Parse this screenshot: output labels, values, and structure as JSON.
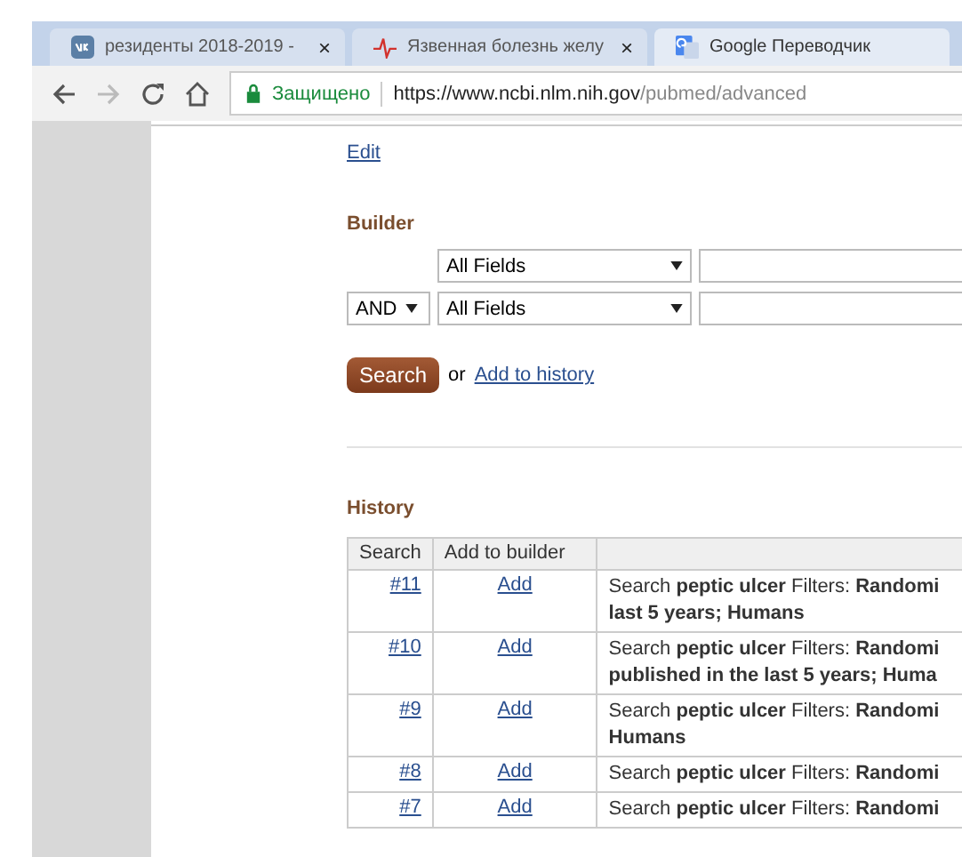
{
  "tabs": [
    {
      "title": "резиденты 2018-2019 - ",
      "close": "×",
      "selected": false
    },
    {
      "title": "Язвенная болезнь желу",
      "close": "×",
      "selected": false
    },
    {
      "title": "Google Переводчик",
      "selected": true
    }
  ],
  "address_bar": {
    "security": "Защищено",
    "origin": "https://www.ncbi.nlm.nih.gov",
    "path": "/pubmed/advanced"
  },
  "edit_link": "Edit",
  "builder": {
    "heading": "Builder",
    "rows": [
      {
        "field": "All Fields"
      },
      {
        "operator": "AND",
        "field": "All Fields"
      }
    ],
    "search_button": "Search",
    "or_text": "or",
    "add_to_history": "Add to history"
  },
  "history": {
    "heading": "History",
    "columns": [
      "Search",
      "Add to builder"
    ],
    "rows": [
      {
        "number": "#11",
        "action": "Add",
        "lines": [
          "Search **peptic ulcer** Filters: **Randomi**",
          "**last 5 years; Humans**"
        ]
      },
      {
        "number": "#10",
        "action": "Add",
        "lines": [
          "Search **peptic ulcer** Filters: **Randomi**",
          "**published in the last 5 years; Huma**"
        ]
      },
      {
        "number": "#9",
        "action": "Add",
        "lines": [
          "Search **peptic ulcer** Filters: **Randomi**",
          "**Humans**"
        ]
      },
      {
        "number": "#8",
        "action": "Add",
        "lines": [
          "Search **peptic ulcer** Filters: **Randomi**"
        ]
      },
      {
        "number": "#7",
        "action": "Add",
        "lines": [
          "Search **peptic ulcer** Filters: **Randomi**"
        ]
      }
    ]
  }
}
